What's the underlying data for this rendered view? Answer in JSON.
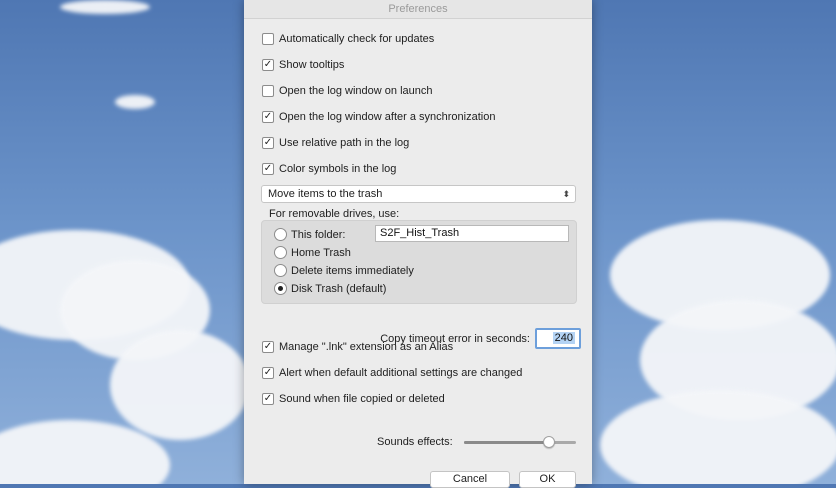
{
  "window": {
    "title": "Preferences"
  },
  "checks_top": [
    {
      "label": "Automatically check for updates",
      "checked": false
    },
    {
      "label": "Show tooltips",
      "checked": true
    },
    {
      "label": "Open the log window on launch",
      "checked": false
    },
    {
      "label": "Open the log window after a synchronization",
      "checked": true
    },
    {
      "label": "Use relative path in the log",
      "checked": true
    },
    {
      "label": "Color symbols in the log",
      "checked": true
    }
  ],
  "trash_select": {
    "value": "Move items to the trash"
  },
  "removable": {
    "label": "For removable drives, use:",
    "folder_value": "S2F_Hist_Trash",
    "options": [
      {
        "label": "This folder:",
        "selected": false
      },
      {
        "label": "Home Trash",
        "selected": false
      },
      {
        "label": "Delete items immediately",
        "selected": false
      },
      {
        "label": "Disk Trash (default)",
        "selected": true
      }
    ]
  },
  "timeout": {
    "label": "Copy timeout error in seconds:",
    "value": "240"
  },
  "checks_bottom": [
    {
      "label": "Manage \".lnk\" extension as an Alias",
      "checked": true
    },
    {
      "label": "Alert when default additional settings are changed",
      "checked": true
    },
    {
      "label": "Sound when file copied or deleted",
      "checked": true
    }
  ],
  "sounds": {
    "label": "Sounds effects:",
    "level_percent": 76
  },
  "buttons": {
    "cancel": "Cancel",
    "ok": "OK"
  },
  "icons": {
    "checkmark": "checkmark-icon",
    "select": "chevron-updown-icon"
  }
}
